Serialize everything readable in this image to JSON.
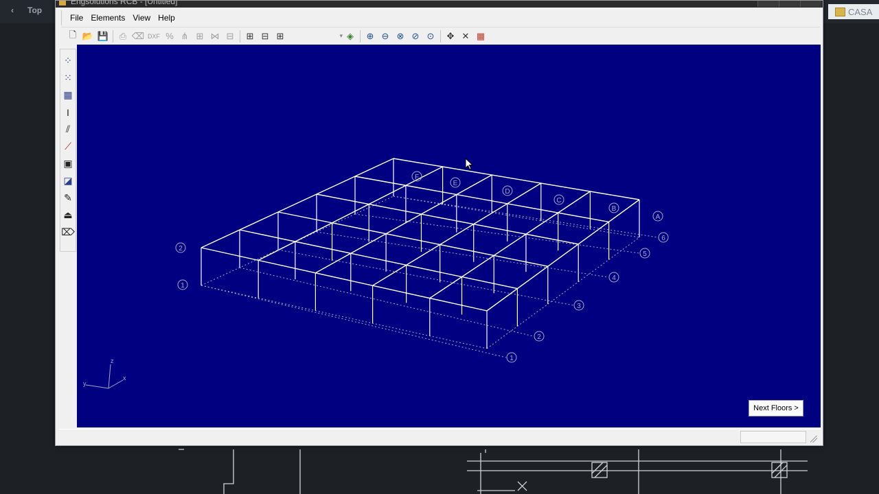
{
  "background": {
    "tabs": [
      "‹",
      "Top"
    ],
    "casa_label": "CASA"
  },
  "window": {
    "title": "Engsolutions RCB - [Untitled]",
    "menu": [
      "File",
      "Elements",
      "View",
      "Help"
    ],
    "toolbar_text": {
      "dxf": "DXF"
    },
    "next_floors_label": "Next Floors >"
  },
  "structure": {
    "row_axes": [
      "1",
      "2",
      "3",
      "4",
      "5",
      "6"
    ],
    "col_axes": [
      "A",
      "B",
      "C",
      "D",
      "E",
      "F"
    ],
    "left_axes": [
      "1",
      "2"
    ]
  },
  "colors": {
    "canvas": "#000080",
    "frame": "#ffffff",
    "gridline": "#a8a8c8",
    "axis_label": "#6670d8"
  },
  "triad": {
    "x": "x",
    "y": "y",
    "z": "z"
  }
}
